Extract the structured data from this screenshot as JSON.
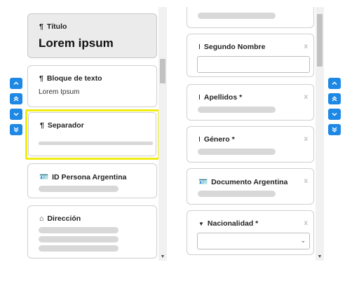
{
  "left_panel": {
    "title_card": {
      "label": "Título",
      "value": "Lorem ipsum",
      "icon": "paragraph-icon"
    },
    "text_block_card": {
      "label": "Bloque de texto",
      "value": "Lorem Ipsum",
      "icon": "paragraph-icon"
    },
    "separator_card": {
      "label": "Separador",
      "icon": "paragraph-icon",
      "selected_border_color": "#f0ec12"
    },
    "id_card": {
      "label": "ID Persona Argentina",
      "icon": "id-card-icon"
    },
    "address_card": {
      "label": "Dirección",
      "icon": "home-icon"
    }
  },
  "right_panel": {
    "second_name_card": {
      "label": "Segundo Nombre",
      "close": "x",
      "icon": "text-cursor-icon"
    },
    "surnames_card": {
      "label": "Apellidos *",
      "close": "x",
      "icon": "text-cursor-icon"
    },
    "gender_card": {
      "label": "Género *",
      "close": "x",
      "icon": "text-cursor-icon"
    },
    "document_card": {
      "label": "Documento Argentina",
      "close": "x",
      "icon": "id-card-icon"
    },
    "nationality_card": {
      "label": "Nacionalidad *",
      "close": "x",
      "icon": "caret-down-icon"
    }
  },
  "colors": {
    "accent": "#1e88e5",
    "selection": "#f0ec12"
  }
}
